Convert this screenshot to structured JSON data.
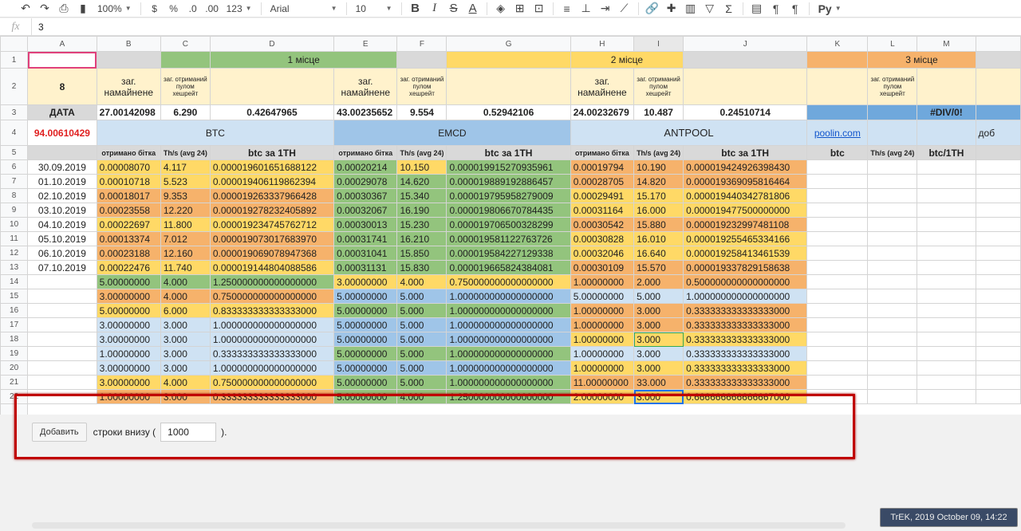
{
  "toolbar": {
    "zoom": "100%",
    "currency": "$",
    "percent": "%",
    "dec_less": ".0",
    "dec_more": ".00",
    "format": "123",
    "font": "Arial",
    "size": "10",
    "text_color": "A",
    "rus": "Py"
  },
  "formula": {
    "fx": "fx",
    "value": "3"
  },
  "columns": [
    "A",
    "B",
    "C",
    "D",
    "E",
    "F",
    "G",
    "H",
    "I",
    "J",
    "K",
    "L",
    "M"
  ],
  "rows": [
    "1",
    "2",
    "3",
    "4",
    "5",
    "6",
    "7",
    "8",
    "9",
    "10",
    "11",
    "12",
    "13",
    "14",
    "15",
    "16",
    "17",
    "18",
    "19",
    "20",
    "21",
    "22"
  ],
  "header": {
    "place1": "1 місце",
    "place2": "2 місце",
    "place3": "3 місце",
    "a2": "8",
    "zag_nam": "заг. намайнене",
    "zag_otr": "заг. отриманий пулом хешрейт",
    "data": "ДАТА",
    "b3": "27.00142098",
    "c3": "6.290",
    "d3": "0.42647965",
    "e3": "43.00235652",
    "f3": "9.554",
    "g3": "0.52942106",
    "h3": "24.00232679",
    "i3": "10.487",
    "j3": "0.24510714",
    "m3": "#DIV/0!",
    "a4": "94.00610429",
    "btc": "BTC",
    "emcd": "EMCD",
    "antpool": "ANTPOOL",
    "poolin": "poolin.com",
    "dob": "доб",
    "otr": "отримано бітка",
    "ths": "Th/s (avg 24)",
    "btc1th": "btc за 1TH",
    "k5": "btc",
    "m5": "btc/1TH"
  },
  "data_rows": [
    [
      "30.09.2019",
      "0.00008070",
      "4.117",
      "0.000019601651688122",
      "0.00020214",
      "10.150",
      "0.000019915270935961",
      "0.00019794",
      "10.190",
      "0.000019424926398430"
    ],
    [
      "01.10.2019",
      "0.00010718",
      "5.523",
      "0.000019406119862394",
      "0.00029078",
      "14.620",
      "0.000019889192886457",
      "0.00028705",
      "14.820",
      "0.000019369095816464"
    ],
    [
      "02.10.2019",
      "0.00018017",
      "9.353",
      "0.000019263337966428",
      "0.00030367",
      "15.340",
      "0.000019795958279009",
      "0.00029491",
      "15.170",
      "0.000019440342781806"
    ],
    [
      "03.10.2019",
      "0.00023558",
      "12.220",
      "0.000019278232405892",
      "0.00032067",
      "16.190",
      "0.000019806670784435",
      "0.00031164",
      "16.000",
      "0.000019477500000000"
    ],
    [
      "04.10.2019",
      "0.00022697",
      "11.800",
      "0.000019234745762712",
      "0.00030013",
      "15.230",
      "0.000019706500328299",
      "0.00030542",
      "15.880",
      "0.000019232997481108"
    ],
    [
      "05.10.2019",
      "0.00013374",
      "7.012",
      "0.000019073017683970",
      "0.00031741",
      "16.210",
      "0.000019581122763726",
      "0.00030828",
      "16.010",
      "0.000019255465334166"
    ],
    [
      "06.10.2019",
      "0.00023188",
      "12.160",
      "0.000019069078947368",
      "0.00031041",
      "15.850",
      "0.000019584227129338",
      "0.00032046",
      "16.640",
      "0.000019258413461539"
    ],
    [
      "07.10.2019",
      "0.00022476",
      "11.740",
      "0.000019144804088586",
      "0.00031131",
      "15.830",
      "0.000019665824384081",
      "0.00030109",
      "15.570",
      "0.000019337829158638"
    ],
    [
      "",
      "5.00000000",
      "4.000",
      "1.250000000000000000",
      "3.00000000",
      "4.000",
      "0.750000000000000000",
      "1.00000000",
      "2.000",
      "0.500000000000000000"
    ],
    [
      "",
      "3.00000000",
      "4.000",
      "0.750000000000000000",
      "5.00000000",
      "5.000",
      "1.000000000000000000",
      "5.00000000",
      "5.000",
      "1.000000000000000000"
    ],
    [
      "",
      "5.00000000",
      "6.000",
      "0.833333333333333000",
      "5.00000000",
      "5.000",
      "1.000000000000000000",
      "1.00000000",
      "3.000",
      "0.333333333333333000"
    ],
    [
      "",
      "3.00000000",
      "3.000",
      "1.000000000000000000",
      "5.00000000",
      "5.000",
      "1.000000000000000000",
      "1.00000000",
      "3.000",
      "0.333333333333333000"
    ],
    [
      "",
      "3.00000000",
      "3.000",
      "1.000000000000000000",
      "5.00000000",
      "5.000",
      "1.000000000000000000",
      "1.00000000",
      "3.000",
      "0.333333333333333000"
    ],
    [
      "",
      "1.00000000",
      "3.000",
      "0.333333333333333000",
      "5.00000000",
      "5.000",
      "1.000000000000000000",
      "1.00000000",
      "3.000",
      "0.333333333333333000"
    ],
    [
      "",
      "3.00000000",
      "3.000",
      "1.000000000000000000",
      "5.00000000",
      "5.000",
      "1.000000000000000000",
      "1.00000000",
      "3.000",
      "0.333333333333333000"
    ],
    [
      "",
      "3.00000000",
      "4.000",
      "0.750000000000000000",
      "5.00000000",
      "5.000",
      "1.000000000000000000",
      "11.00000000",
      "33.000",
      "0.333333333333333000"
    ],
    [
      "",
      "1.00000000",
      "3.000",
      "0.333333333333333000",
      "5.00000000",
      "4.000",
      "1.250000000000000000",
      "2.00000000",
      "3.000",
      "0.666666666666667000"
    ]
  ],
  "colors": {
    "green": "#93c47d",
    "yellow": "#ffd966",
    "orange": "#f6b26b",
    "blue": "#9fc5e8",
    "light_blue": "#cfe2f3",
    "cream": "#fff2cc",
    "gray": "#d9d9d9"
  },
  "row_fill": [
    [
      "y",
      "y",
      "y",
      "g",
      "y",
      "g",
      "o",
      "o",
      "o"
    ],
    [
      "y",
      "y",
      "y",
      "g",
      "g",
      "g",
      "o",
      "o",
      "o"
    ],
    [
      "o",
      "o",
      "o",
      "g",
      "g",
      "g",
      "y",
      "y",
      "y"
    ],
    [
      "o",
      "o",
      "o",
      "g",
      "g",
      "g",
      "y",
      "y",
      "y"
    ],
    [
      "y",
      "y",
      "y",
      "g",
      "g",
      "g",
      "o",
      "o",
      "o"
    ],
    [
      "o",
      "o",
      "o",
      "g",
      "g",
      "g",
      "y",
      "y",
      "y"
    ],
    [
      "o",
      "o",
      "o",
      "g",
      "g",
      "g",
      "y",
      "y",
      "y"
    ],
    [
      "y",
      "y",
      "y",
      "g",
      "g",
      "g",
      "o",
      "o",
      "o"
    ],
    [
      "g",
      "g",
      "g",
      "y",
      "y",
      "y",
      "o",
      "o",
      "o"
    ],
    [
      "o",
      "o",
      "o",
      "b",
      "b",
      "b",
      "lb",
      "lb",
      "lb"
    ],
    [
      "y",
      "y",
      "y",
      "g",
      "g",
      "g",
      "o",
      "o",
      "o"
    ],
    [
      "lb",
      "lb",
      "lb",
      "b",
      "b",
      "b",
      "o",
      "o",
      "o"
    ],
    [
      "lb",
      "lb",
      "lb",
      "b",
      "b",
      "b",
      "y",
      "y",
      "y"
    ],
    [
      "lb",
      "lb",
      "lb",
      "g",
      "g",
      "g",
      "lb",
      "lb",
      "lb"
    ],
    [
      "lb",
      "lb",
      "lb",
      "b",
      "b",
      "b",
      "y",
      "y",
      "y"
    ],
    [
      "y",
      "y",
      "y",
      "g",
      "g",
      "g",
      "o",
      "o",
      "o"
    ],
    [
      "o",
      "o",
      "o",
      "g",
      "g",
      "g",
      "y",
      "y",
      "y"
    ]
  ],
  "addrow": {
    "button": "Добавить",
    "text": "строки внизу (",
    "value": "1000",
    "close": ")."
  },
  "watermark": "TrEK, 2019 October 09, 14:22"
}
